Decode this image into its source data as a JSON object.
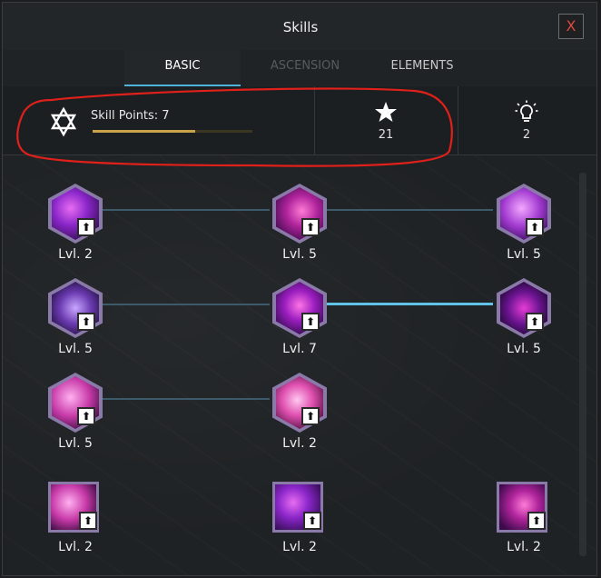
{
  "window": {
    "title": "Skills",
    "close_label": "X"
  },
  "tabs": [
    {
      "label": "BASIC",
      "state": "active"
    },
    {
      "label": "ASCENSION",
      "state": "disabled"
    },
    {
      "label": "ELEMENTS",
      "state": "normal"
    }
  ],
  "stats": {
    "skill_points_label": "Skill Points: 7",
    "skill_points_progress": 0.64,
    "stars_icon": "star-icon",
    "stars_value": "21",
    "ideas_icon": "lightbulb-icon",
    "ideas_value": "2"
  },
  "skills": [
    {
      "level": "Lvl. 2",
      "shape": "hex",
      "palette": "violet"
    },
    {
      "level": "Lvl. 5",
      "shape": "hex",
      "palette": "magenta"
    },
    {
      "level": "Lvl. 5",
      "shape": "hex",
      "palette": "orchid"
    },
    {
      "level": "Lvl. 5",
      "shape": "hex",
      "palette": "indigo"
    },
    {
      "level": "Lvl. 7",
      "shape": "hex",
      "palette": "purple"
    },
    {
      "level": "Lvl. 5",
      "shape": "hex",
      "palette": "deep"
    },
    {
      "level": "Lvl. 5",
      "shape": "hex",
      "palette": "pink"
    },
    {
      "level": "Lvl. 2",
      "shape": "hex",
      "palette": "rose"
    },
    {
      "level": "Lvl. 2",
      "shape": "square",
      "palette": "pink"
    },
    {
      "level": "Lvl. 2",
      "shape": "square",
      "palette": "violet"
    },
    {
      "level": "Lvl. 2",
      "shape": "square",
      "palette": "magenta"
    }
  ],
  "colors": {
    "accent_blue": "#4fb3d9",
    "gold": "#c9a24a",
    "annotation_red": "#e0201a",
    "close_red": "#e0483b"
  }
}
